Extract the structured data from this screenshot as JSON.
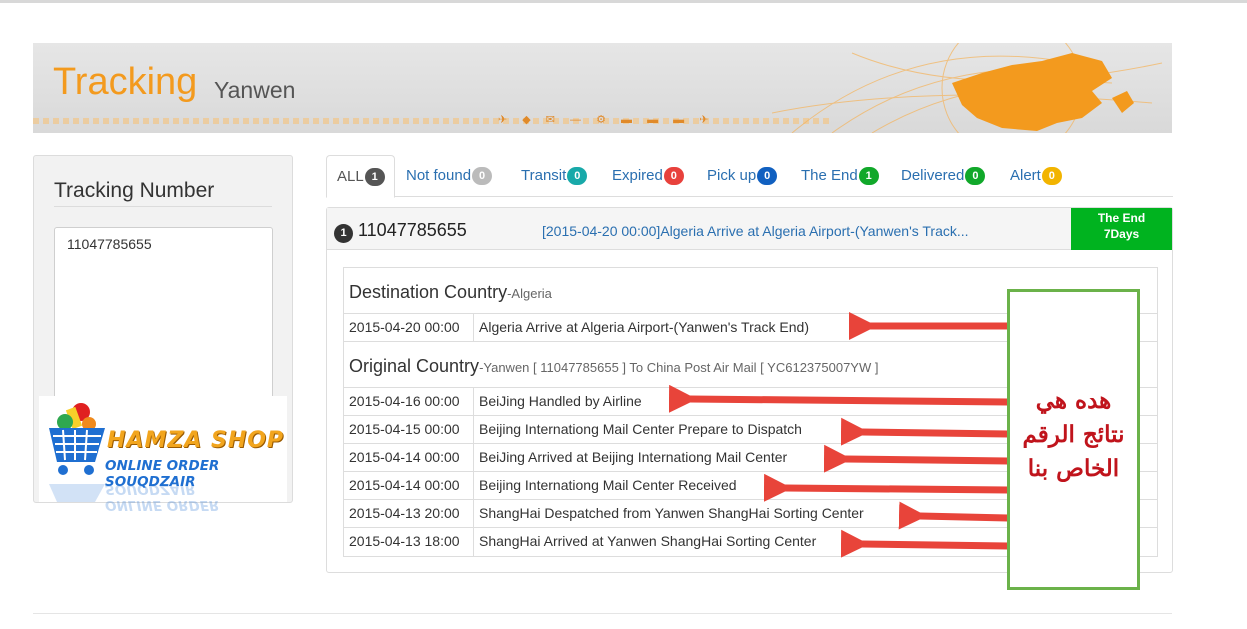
{
  "banner": {
    "title": "Tracking",
    "subtitle": "Yanwen"
  },
  "sidebar": {
    "title": "Tracking Number",
    "input_value": "11047785655"
  },
  "logo": {
    "name": "HAMZA SHOP",
    "tagline": "ONLINE ORDER SOUQDZAIR"
  },
  "tabs": [
    {
      "label": "ALL",
      "count": "1",
      "color": "#555555"
    },
    {
      "label": "Not found",
      "count": "0",
      "color": "#bbbbbb"
    },
    {
      "label": "Transit",
      "count": "0",
      "color": "#18a9a9"
    },
    {
      "label": "Expired",
      "count": "0",
      "color": "#e8413c"
    },
    {
      "label": "Pick up",
      "count": "0",
      "color": "#1160c0"
    },
    {
      "label": "The End",
      "count": "1",
      "color": "#11a82a"
    },
    {
      "label": "Delivered",
      "count": "0",
      "color": "#11a82a"
    },
    {
      "label": "Alert",
      "count": "0",
      "color": "#f2b400"
    }
  ],
  "result": {
    "index": "1",
    "number": "11047785655",
    "last_event": "[2015-04-20 00:00]Algeria Arrive at Algeria Airport-(Yanwen's Track...",
    "status_line1": "The End",
    "status_line2": "7Days",
    "status_color": "#00b31f"
  },
  "destination": {
    "title": "Destination Country",
    "sub": "-Algeria",
    "events": [
      {
        "date": "2015-04-20 00:00",
        "info": "Algeria Arrive at Algeria Airport-(Yanwen's Track End)"
      }
    ]
  },
  "origin": {
    "title": "Original Country",
    "sub": "-Yanwen [ 11047785655 ]  To China Post Air Mail [ YC612375007YW ]",
    "events": [
      {
        "date": "2015-04-16 00:00",
        "info": "BeiJing Handled by Airline"
      },
      {
        "date": "2015-04-15 00:00",
        "info": "Beijing Internationg Mail Center Prepare to Dispatch"
      },
      {
        "date": "2015-04-14 00:00",
        "info": "BeiJing Arrived at Beijing Internationg Mail Center"
      },
      {
        "date": "2015-04-14 00:00",
        "info": "Beijing Internationg Mail Center Received"
      },
      {
        "date": "2015-04-13 20:00",
        "info": "ShangHai Despatched from Yanwen ShangHai Sorting Center"
      },
      {
        "date": "2015-04-13 18:00",
        "info": "ShangHai Arrived at Yanwen ShangHai Sorting Center"
      }
    ]
  },
  "annotation": {
    "line1": "هده هي",
    "line2": "نتائج الرقم",
    "line3": "الخاص بنا",
    "arrow_color": "#e8443a",
    "border_color": "#6bb24a"
  }
}
